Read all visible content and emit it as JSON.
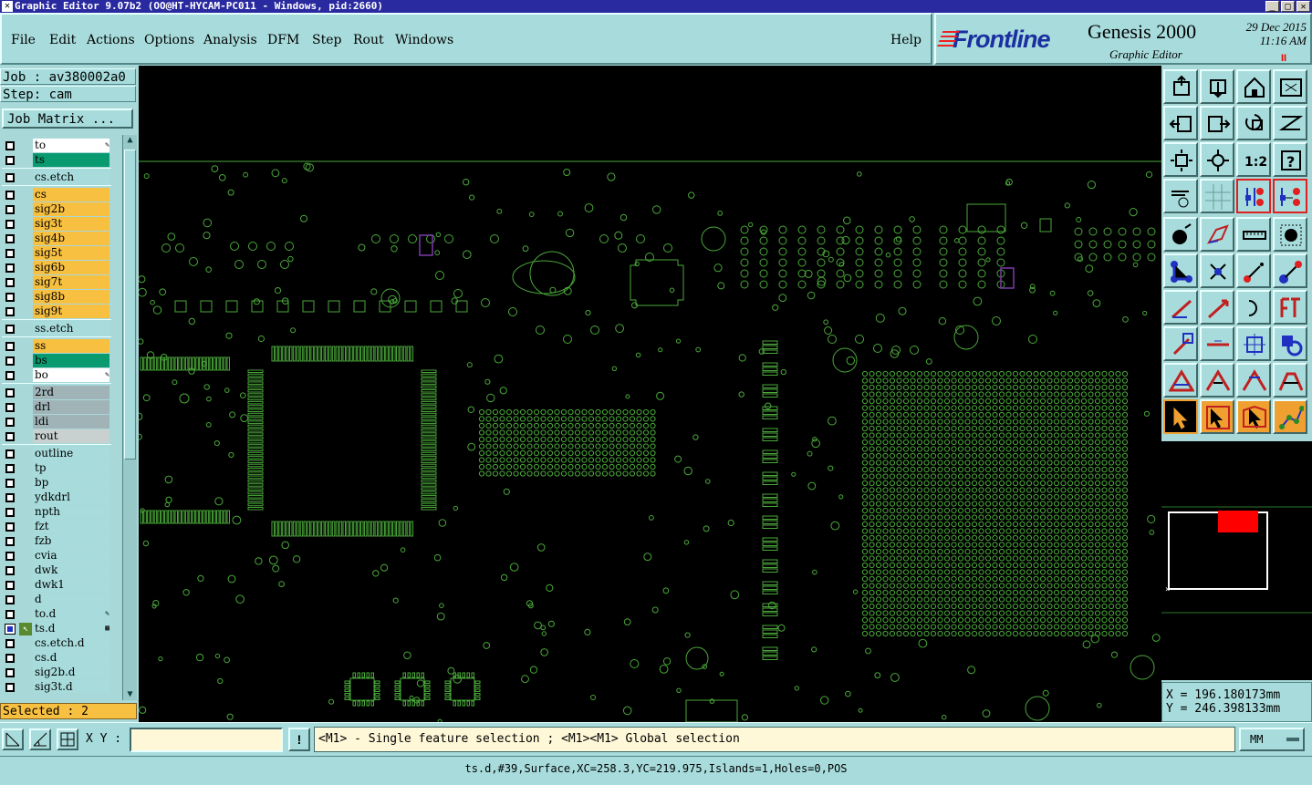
{
  "window": {
    "title": "Graphic Editor 9.07b2 (OO@HT-HYCAM-PC011 - Windows, pid:2660)"
  },
  "menu": [
    {
      "label": "File"
    },
    {
      "label": "Edit"
    },
    {
      "label": "Actions"
    },
    {
      "label": "Options"
    },
    {
      "label": "Analysis"
    },
    {
      "label": "DFM"
    },
    {
      "label": "Step"
    },
    {
      "label": "Rout"
    },
    {
      "label": "Windows"
    },
    {
      "label": "Help"
    }
  ],
  "brand": {
    "logo": "Frontline",
    "product": "Genesis 2000",
    "subtitle": "Graphic Editor",
    "date": "29 Dec 2015",
    "time": "11:16 AM",
    "pause_mark": "II"
  },
  "job": {
    "job_line": "Job : av380002a0",
    "step_line": "Step: cam",
    "matrix_button": "Job Matrix ..."
  },
  "layers": [
    {
      "name": "to",
      "color": "#ffffff",
      "mark": "✎"
    },
    {
      "name": "ts",
      "color": "#0a9a70"
    },
    {
      "name": "cs.etch",
      "color": "#a8dcdc"
    },
    {
      "name": "cs",
      "color": "#f8c040"
    },
    {
      "name": "sig2b",
      "color": "#f8c040"
    },
    {
      "name": "sig3t",
      "color": "#f8c040"
    },
    {
      "name": "sig4b",
      "color": "#f8c040"
    },
    {
      "name": "sig5t",
      "color": "#f8c040"
    },
    {
      "name": "sig6b",
      "color": "#f8c040"
    },
    {
      "name": "sig7t",
      "color": "#f8c040"
    },
    {
      "name": "sig8b",
      "color": "#f8c040"
    },
    {
      "name": "sig9t",
      "color": "#f8c040"
    },
    {
      "name": "ss.etch",
      "color": "#a8dcdc"
    },
    {
      "name": "ss",
      "color": "#f8c040"
    },
    {
      "name": "bs",
      "color": "#0a9a70"
    },
    {
      "name": "bo",
      "color": "#ffffff",
      "mark": "✎"
    },
    {
      "name": "2rd",
      "color": "#a0b4b8"
    },
    {
      "name": "drl",
      "color": "#a0b4b8"
    },
    {
      "name": "ldi",
      "color": "#a0b4b8"
    },
    {
      "name": "rout",
      "color": "#c8d0d0"
    },
    {
      "name": "outline",
      "color": "#a8dcdc"
    },
    {
      "name": "tp",
      "color": "#a8dcdc"
    },
    {
      "name": "bp",
      "color": "#a8dcdc"
    },
    {
      "name": "ydkdrl",
      "color": "#a8dcdc"
    },
    {
      "name": "npth",
      "color": "#a8dcdc"
    },
    {
      "name": "fzt",
      "color": "#a8dcdc"
    },
    {
      "name": "fzb",
      "color": "#a8dcdc"
    },
    {
      "name": "cvia",
      "color": "#a8dcdc"
    },
    {
      "name": "dwk",
      "color": "#a8dcdc"
    },
    {
      "name": "dwk1",
      "color": "#a8dcdc"
    },
    {
      "name": "d",
      "color": "#a8dcdc"
    },
    {
      "name": "to.d",
      "color": "#a8dcdc",
      "mark": "✎"
    },
    {
      "name": "ts.d",
      "color": "#a8dcdc",
      "active": true,
      "mark": "▦"
    },
    {
      "name": "cs.etch.d",
      "color": "#a8dcdc"
    },
    {
      "name": "cs.d",
      "color": "#a8dcdc"
    },
    {
      "name": "sig2b.d",
      "color": "#a8dcdc"
    },
    {
      "name": "sig3t.d",
      "color": "#a8dcdc"
    }
  ],
  "selected_text": "Selected : 2",
  "coords": {
    "x": "X =  196.180173mm",
    "y": "Y =  246.398133mm"
  },
  "bottom": {
    "xy_label": "X Y :",
    "xy_value": "",
    "info_button": "!",
    "hint": "<M1> - Single feature selection ; <M1><M1> Global selection",
    "units": "MM"
  },
  "status": "ts.d,#39,Surface,XC=258.3,YC=219.975,Islands=1,Holes=0,POS",
  "colors": {
    "feature": "#4aa83a",
    "highlight": "#7a3aa8",
    "cursor_box": "#ff0000"
  },
  "toolbar_icons": [
    "zoom-home-icon",
    "zoom-prev-icon",
    "home-icon",
    "zoom-window-icon",
    "pan-left-icon",
    "pan-right-icon",
    "zoom-back-icon",
    "redraw-icon",
    "fit-icon",
    "zoom-center-icon",
    "scale-1-2-icon",
    "help-query-icon",
    "wrench-icon",
    "grid-icon",
    "snap-icon",
    "snap-adv-icon",
    "add-pad-icon",
    "add-polygon-icon",
    "measure-icon",
    "pad-select-icon",
    "connect-icon",
    "cross-icon",
    "arrow-node-icon",
    "move-node-icon",
    "line-draw-icon",
    "line-arrow-icon",
    "arc-icon",
    "text-icon",
    "arrow-down-icon",
    "minus-icon",
    "align-icon",
    "shapes-icon",
    "triangle-icon",
    "triangle-a-icon",
    "triangle-b-icon",
    "triangle-c-icon",
    "select-pointer-icon",
    "select-orange-icon",
    "select-box-icon",
    "select-net-icon"
  ]
}
